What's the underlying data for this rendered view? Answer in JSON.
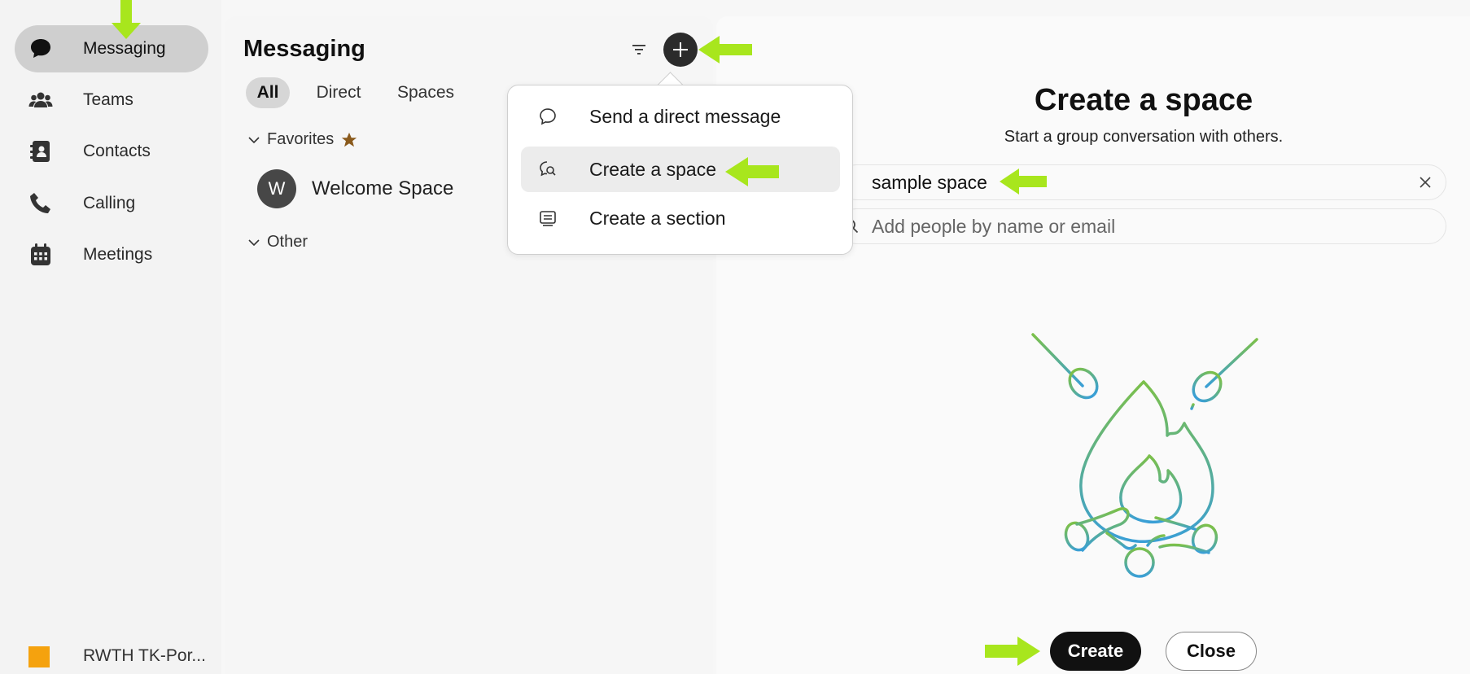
{
  "nav": {
    "items": [
      {
        "label": "Messaging",
        "icon": "chat-bubble-icon",
        "active": true
      },
      {
        "label": "Teams",
        "icon": "people-icon"
      },
      {
        "label": "Contacts",
        "icon": "address-book-icon"
      },
      {
        "label": "Calling",
        "icon": "phone-icon"
      },
      {
        "label": "Meetings",
        "icon": "calendar-icon"
      }
    ],
    "org_label": "RWTH TK-Por..."
  },
  "messaging": {
    "title": "Messaging",
    "tabs": [
      {
        "label": "All",
        "active": true
      },
      {
        "label": "Direct"
      },
      {
        "label": "Spaces"
      }
    ],
    "favorites_label": "Favorites",
    "other_label": "Other",
    "spaces": [
      {
        "initial": "W",
        "name": "Welcome Space"
      }
    ]
  },
  "menu": {
    "items": [
      {
        "label": "Send a direct message",
        "icon": "chat-bubble-outline-icon"
      },
      {
        "label": "Create a space",
        "icon": "chat-search-icon",
        "highlighted": true
      },
      {
        "label": "Create a section",
        "icon": "section-list-icon"
      }
    ]
  },
  "create_space": {
    "title": "Create a space",
    "subtitle": "Start a group conversation with others.",
    "name_value": "sample space",
    "people_placeholder": "Add people by name or email",
    "create_label": "Create",
    "close_label": "Close"
  },
  "colors": {
    "annotation_arrow": "#a8e61d",
    "accent_dark": "#111111",
    "illustration_green": "#7cc04a",
    "illustration_blue": "#3a9fd6"
  }
}
